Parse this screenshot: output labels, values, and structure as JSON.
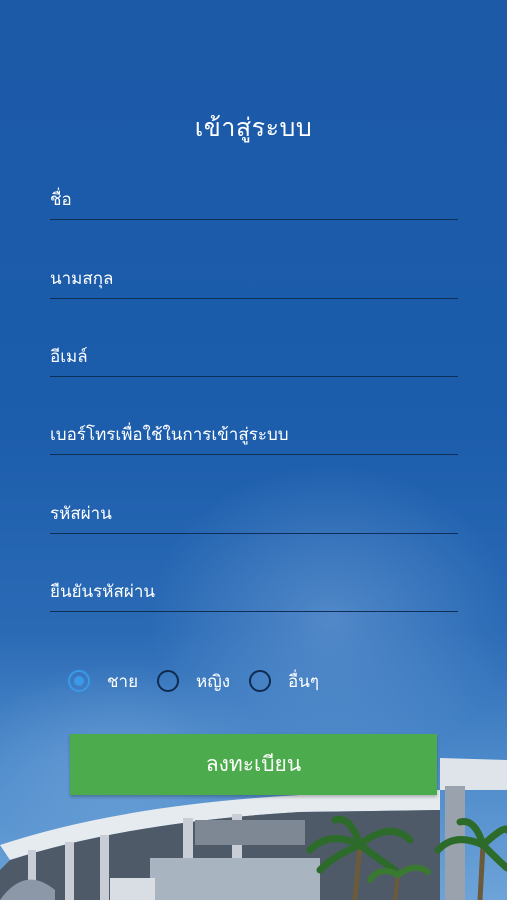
{
  "page": {
    "title": "เข้าสู่ระบบ"
  },
  "form": {
    "first_name_placeholder": "ชื่อ",
    "last_name_placeholder": "นามสกุล",
    "email_placeholder": "อีเมล์",
    "phone_placeholder": "เบอร์โทรเพื่อใช้ในการเข้าสู่ระบบ",
    "password_placeholder": "รหัสผ่าน",
    "confirm_password_placeholder": "ยืนยันรหัสผ่าน"
  },
  "gender": {
    "selected": "male",
    "options": [
      {
        "value": "male",
        "label": "ชาย"
      },
      {
        "value": "female",
        "label": "หญิง"
      },
      {
        "value": "other",
        "label": "อื่นๆ"
      }
    ]
  },
  "actions": {
    "register_label": "ลงทะเบียน"
  },
  "colors": {
    "background": "#1b5cab",
    "button": "#4cab4c",
    "radio_selected": "#3a9ae8",
    "underline": "#0f2f56"
  }
}
